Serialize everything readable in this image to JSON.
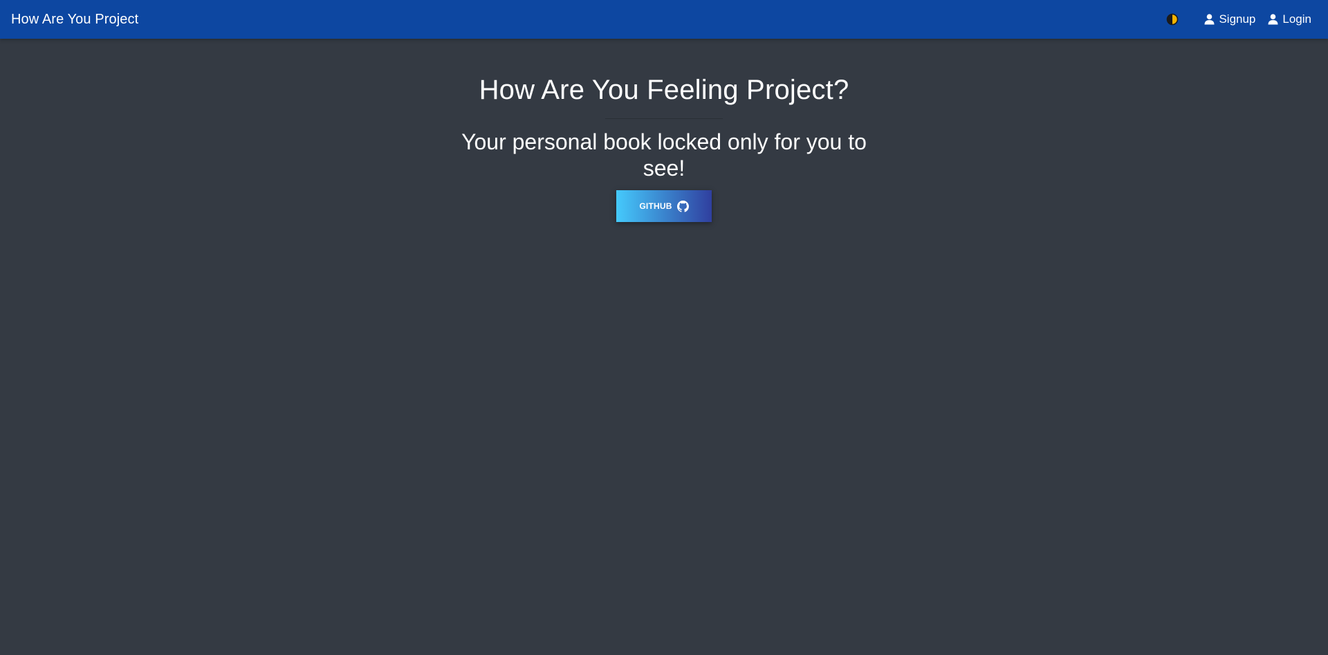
{
  "navbar": {
    "brand": "How Are You Project",
    "theme_toggle_icon": "half-moon-contrast-icon",
    "links": [
      {
        "label": "Signup",
        "icon": "user-icon"
      },
      {
        "label": "Login",
        "icon": "user-icon"
      }
    ]
  },
  "hero": {
    "title": "How Are You Feeling Project?",
    "subtitle": "Your personal book locked only for you to see!",
    "button_label": "GITHUB",
    "button_icon": "github-icon"
  },
  "colors": {
    "navbar_bg": "#0d47a1",
    "page_bg": "#343a43",
    "button_gradient_start": "#45cafc",
    "button_gradient_end": "#303f9f",
    "toggle_accent": "#f5b400"
  }
}
